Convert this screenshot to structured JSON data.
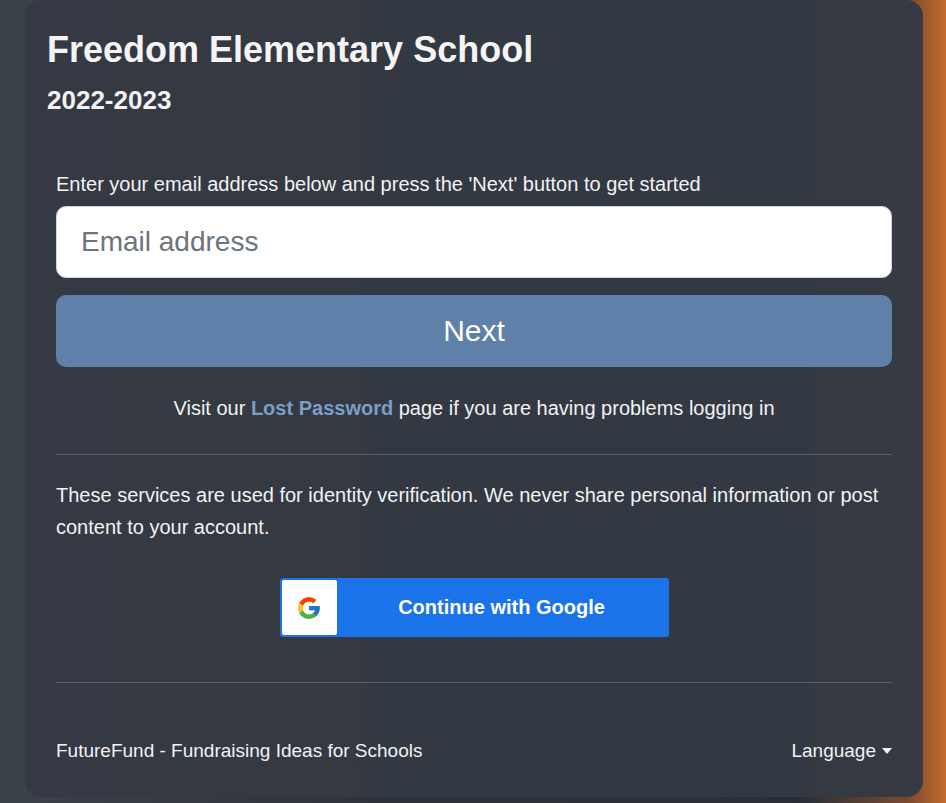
{
  "school": {
    "name": "Freedom Elementary School",
    "year": "2022-2023"
  },
  "prompt": "Enter your email address below and press the 'Next' button to get started",
  "email_field": {
    "placeholder": "Email address"
  },
  "next_button": {
    "label": "Next"
  },
  "help": {
    "before": "Visit our",
    "link": "Lost Password",
    "after": "page if you are having problems logging in"
  },
  "notice": "These services are used for identity verification. We never share personal information or post content to your account.",
  "google_button": {
    "label": "Continue with Google"
  },
  "footer": {
    "brand": "FutureFund - Fundraising Ideas for Schools",
    "language": "Language"
  }
}
